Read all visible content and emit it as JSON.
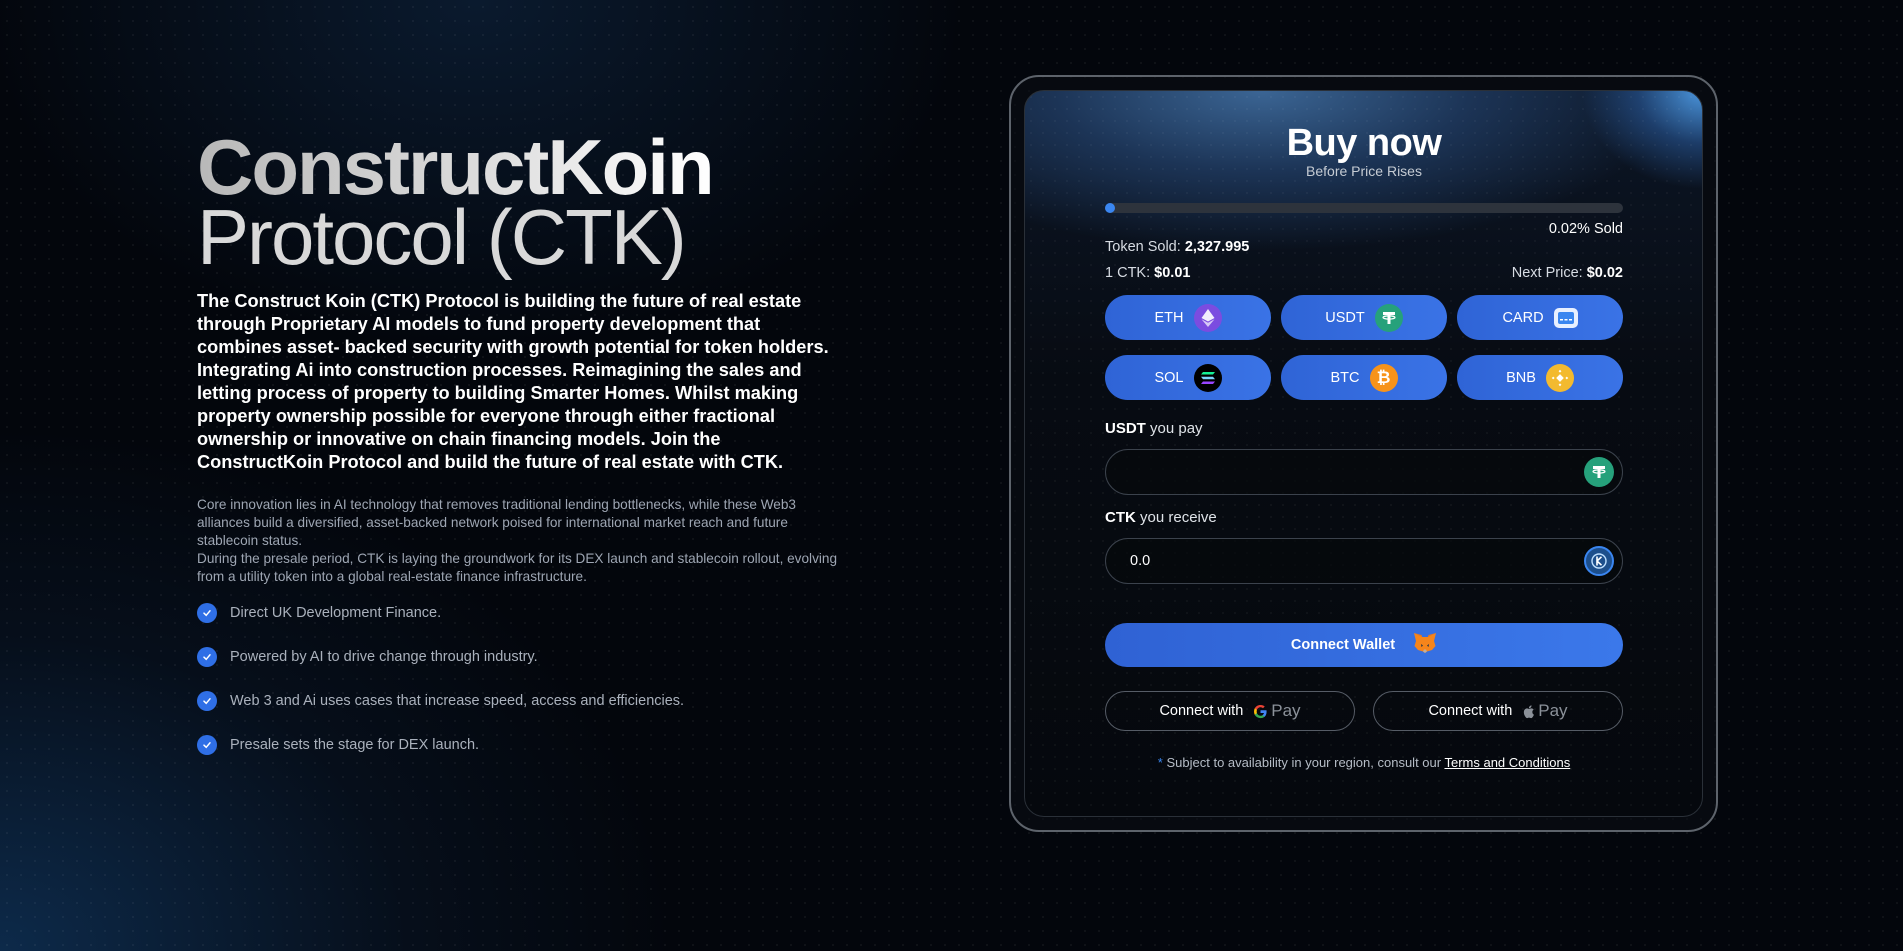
{
  "hero": {
    "title_bold": "ConstructKoin",
    "title_light": "Protocol (CTK)",
    "lead": "The Construct Koin (CTK) Protocol is building the future of real estate through Proprietary AI models to fund property development that combines asset- backed security with growth potential for token holders. Integrating Ai into construction processes. Reimagining the sales and letting process of property to building Smarter Homes. Whilst making property ownership possible for everyone through either fractional ownership or innovative on chain financing models. Join the ConstructKoin Protocol and build the future of real estate with CTK.",
    "body_1": "Core innovation lies in AI technology that removes traditional lending bottlenecks, while these Web3 alliances build a diversified, asset-backed network poised for international market reach and future stablecoin status.",
    "body_2": "During the presale period, CTK is laying the groundwork for its DEX launch and stablecoin rollout, evolving from a utility token into a global real-estate finance infrastructure.",
    "features": [
      "Direct UK Development Finance.",
      "Powered by AI to drive change through industry.",
      "Web 3 and Ai uses cases that increase speed, access and efficiencies.",
      "Presale sets the stage for DEX launch."
    ]
  },
  "widget": {
    "title": "Buy now",
    "subtitle": "Before Price Rises",
    "progress_fraction": 0.0002,
    "sold_text": "0.02% Sold",
    "token_sold_label": "Token Sold:",
    "token_sold_value": "2,327.995",
    "price_label": "1 CTK:",
    "price_value": "$0.01",
    "next_price_label": "Next Price:",
    "next_price_value": "$0.02",
    "pay_options": [
      {
        "label": "ETH",
        "icon": "eth-icon"
      },
      {
        "label": "USDT",
        "icon": "usdt-icon"
      },
      {
        "label": "CARD",
        "icon": "card-icon"
      },
      {
        "label": "SOL",
        "icon": "sol-icon"
      },
      {
        "label": "BTC",
        "icon": "btc-icon"
      },
      {
        "label": "BNB",
        "icon": "bnb-icon"
      }
    ],
    "pay_field": {
      "currency": "USDT",
      "label": "you pay",
      "value": ""
    },
    "receive_field": {
      "currency": "CTK",
      "label": "you receive",
      "value": "0.0"
    },
    "connect_wallet": "Connect Wallet",
    "connect_with": "Connect with",
    "gpay": "Pay",
    "applepay": "Pay",
    "note_star": "*",
    "note_text": "Subject to availability in your region, consult our",
    "note_link": "Terms and Conditions"
  },
  "colors": {
    "accent": "#3A73E6",
    "usdt": "#26A17B",
    "btc": "#F7931A",
    "bnb": "#F3BA2F",
    "eth": "#7B4CE0"
  }
}
